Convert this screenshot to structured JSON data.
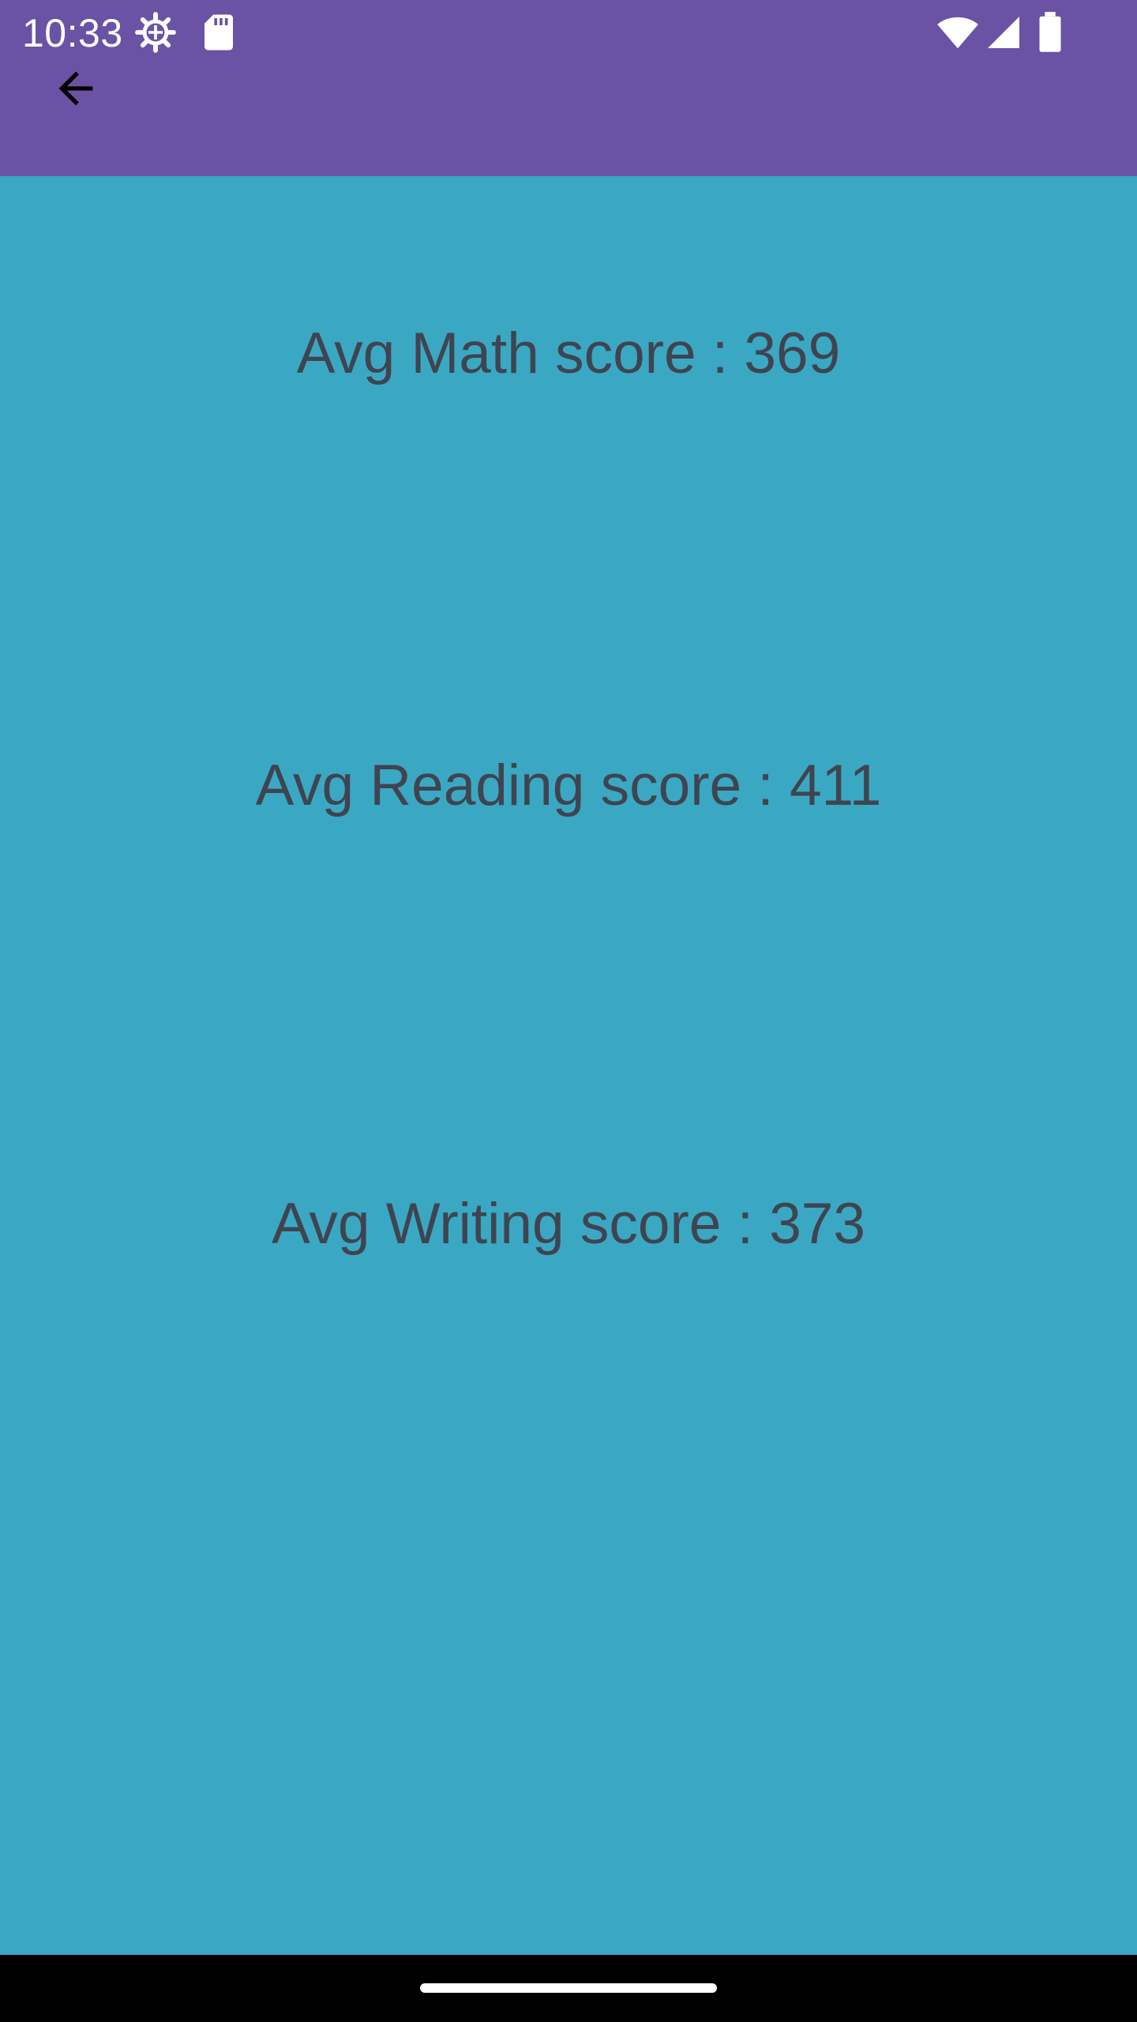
{
  "status_bar": {
    "time": "10:33",
    "icons": [
      "gear-icon",
      "sdcard-icon",
      "wifi-icon",
      "signal-icon",
      "battery-icon"
    ]
  },
  "app_bar": {
    "back_icon": "arrow-left-icon",
    "color": "#6a52a5"
  },
  "scores": {
    "math": "Avg Math score : 369",
    "reading": "Avg Reading score : 411",
    "writing": "Avg Writing score : 373"
  },
  "colors": {
    "background": "#3ba8c3",
    "text": "#3f4451"
  }
}
